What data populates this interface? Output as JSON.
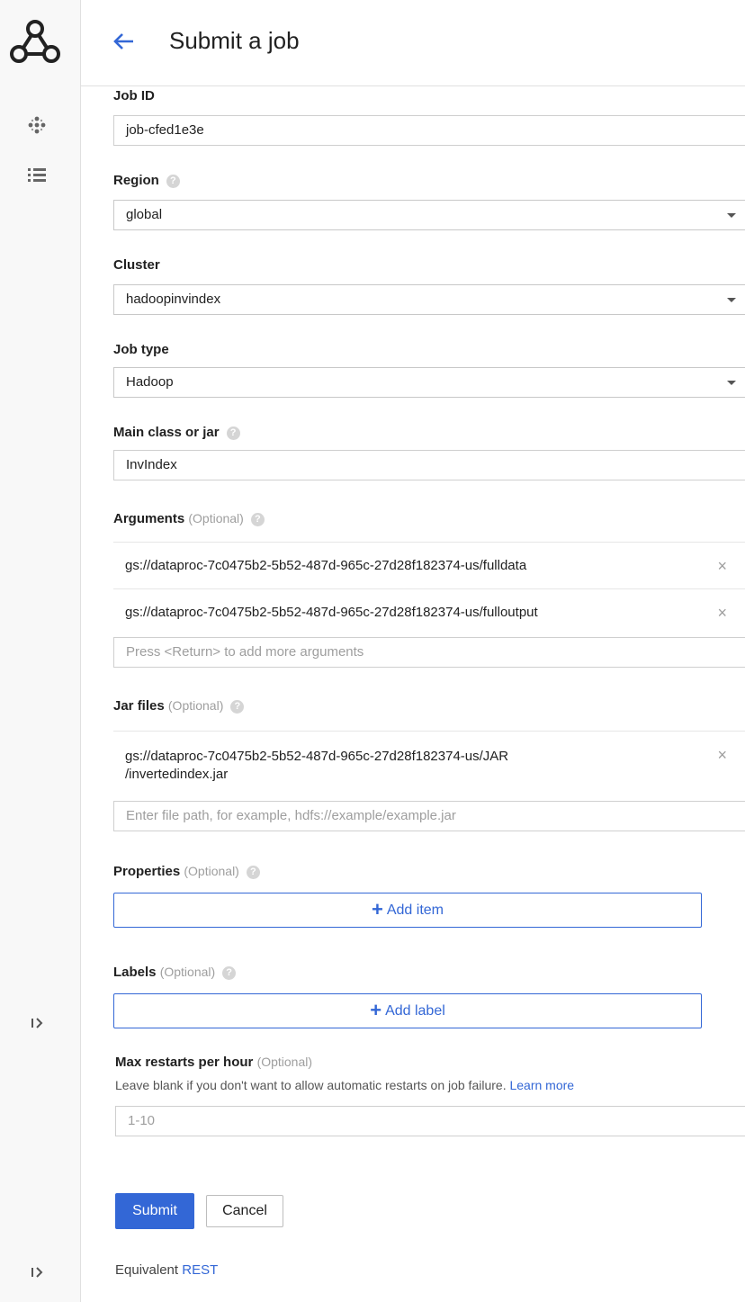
{
  "header": {
    "title": "Submit a job"
  },
  "form": {
    "job_id": {
      "label": "Job ID",
      "value": "job-cfed1e3e"
    },
    "region": {
      "label": "Region",
      "value": "global"
    },
    "cluster": {
      "label": "Cluster",
      "value": "hadoopinvindex"
    },
    "job_type": {
      "label": "Job type",
      "value": "Hadoop"
    },
    "main_class": {
      "label": "Main class or jar",
      "value": "InvIndex"
    },
    "arguments": {
      "label": "Arguments",
      "optional": "(Optional)",
      "items": [
        "gs://dataproc-7c0475b2-5b52-487d-965c-27d28f182374-us/fulldata",
        "gs://dataproc-7c0475b2-5b52-487d-965c-27d28f182374-us/fulloutput"
      ],
      "placeholder": "Press <Return> to add more arguments"
    },
    "jar_files": {
      "label": "Jar files",
      "optional": "(Optional)",
      "items": [
        {
          "line1": "gs://dataproc-7c0475b2-5b52-487d-965c-27d28f182374-us/JAR",
          "line2": "/invertedindex.jar"
        }
      ],
      "placeholder": "Enter file path, for example, hdfs://example/example.jar"
    },
    "properties": {
      "label": "Properties",
      "optional": "(Optional)",
      "add_label": "Add item"
    },
    "labels": {
      "label": "Labels",
      "optional": "(Optional)",
      "add_label": "Add label"
    },
    "max_restarts": {
      "label": "Max restarts per hour",
      "optional": "(Optional)",
      "hint": "Leave blank if you don't want to allow automatic restarts on job failure.",
      "hint_link": "Learn more",
      "placeholder": "1-10"
    }
  },
  "actions": {
    "submit": "Submit",
    "cancel": "Cancel"
  },
  "footer": {
    "prefix": "Equivalent",
    "link": "REST"
  },
  "icons": {
    "help": "?",
    "remove": "×",
    "plus": "+"
  },
  "colors": {
    "accent": "#3367d6",
    "rail": "#f8f8f8"
  }
}
